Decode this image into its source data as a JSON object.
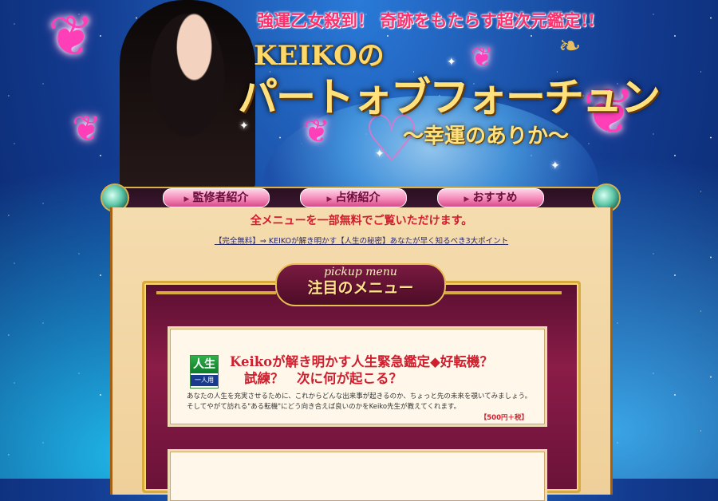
{
  "header": {
    "tagline": "強運乙女殺到！ 奇跡をもたらす超次元鑑定!!",
    "brand": "KEIKOの",
    "title": "パートォブフォーチュン",
    "subtitle": "〜幸運のありか〜"
  },
  "nav": {
    "items": [
      {
        "label": "監修者紹介"
      },
      {
        "label": "占術紹介"
      },
      {
        "label": "おすすめ"
      }
    ]
  },
  "main": {
    "notice": "全メニューを一部無料でご覧いただけます。",
    "free_link": "【完全無料】⇒ KEIKOが解き明かす【人生の秘密】あなたが早く知るべき3大ポイント",
    "pickup": {
      "label_en": "pickup menu",
      "label_jp": "注目のメニュー"
    },
    "card": {
      "badge_top": "人生",
      "badge_bottom": "一人用",
      "title_line1": "Keikoが解き明かす人生緊急鑑定◆好転機？",
      "title_line2": "試練？　次に何が起こる？",
      "description": "あなたの人生を充実させるために、これからどんな出来事が起きるのか、ちょっと先の未来を覗いてみましょう。そしてやがて訪れる\"ある転機\"にどう向き合えば良いのかをKeiko先生が教えてくれます。",
      "price": "【500円＋税】"
    }
  },
  "colors": {
    "accent_red": "#d11e2e",
    "gold": "#d9aa3c",
    "nav_pink": "#f58ab9",
    "frame_maroon": "#7a1a42"
  }
}
